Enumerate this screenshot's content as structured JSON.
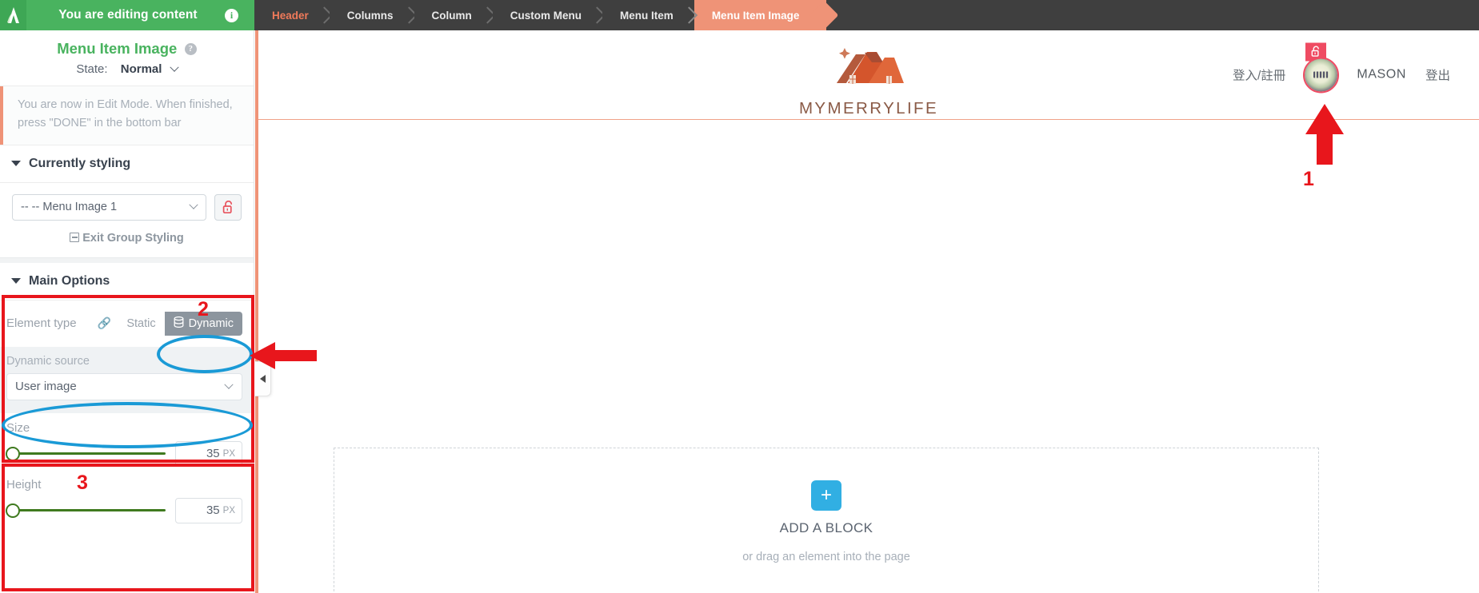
{
  "topbar": {
    "editing_text": "You are editing content",
    "info_icon": "info-icon",
    "breadcrumbs": [
      {
        "label": "Header",
        "state": "first"
      },
      {
        "label": "Columns",
        "state": "normal"
      },
      {
        "label": "Column",
        "state": "normal"
      },
      {
        "label": "Custom Menu",
        "state": "normal"
      },
      {
        "label": "Menu Item",
        "state": "normal"
      },
      {
        "label": "Menu Item Image",
        "state": "active"
      }
    ]
  },
  "sidebar": {
    "panel_title": "Menu Item Image",
    "help_icon": "question-mark-icon",
    "state_label": "State:",
    "state_value": "Normal",
    "notice": "You are now in Edit Mode. When finished, press \"DONE\" in the bottom bar",
    "currently_styling": {
      "section_label": "Currently styling",
      "selected_element": "-- -- Menu Image 1",
      "lock_icon": "unlocked-padlock-icon",
      "exit_group_label": "Exit Group Styling"
    },
    "main_options": {
      "section_label": "Main Options",
      "element_type_label": "Element type",
      "chain_icon": "link-chain-icon",
      "static_label": "Static",
      "dynamic_label": "Dynamic",
      "dynamic_icon": "database-icon",
      "selected_type": "Dynamic",
      "dynamic_source_label": "Dynamic source",
      "dynamic_source_value": "User image"
    },
    "size_options": {
      "size_label": "Size",
      "size_value": "35",
      "size_unit": "PX",
      "height_label": "Height",
      "height_value": "35",
      "height_unit": "PX"
    }
  },
  "preview": {
    "brand_name": "MYMERRYLIFE",
    "logo_icon": "house-roof-logo-icon",
    "nav": {
      "login_register": "登入/註冊",
      "username": "MASON",
      "logout": "登出",
      "avatar_icon": "user-avatar",
      "avatar_badge_icon": "unlocked-padlock-icon"
    },
    "add_block": {
      "plus_icon": "plus-icon",
      "title": "ADD A BLOCK",
      "subtitle": "or drag an element into the page"
    }
  },
  "annotations": {
    "marker_1": "1",
    "marker_2": "2",
    "marker_3": "3",
    "arrow_up_icon": "red-up-arrow-icon",
    "arrow_left_icon": "red-left-arrow-icon",
    "collapse_icon": "collapse-panel-icon"
  },
  "colors": {
    "green": "#49b35f",
    "salmon": "#ef9377",
    "annotation_red": "#e8161c",
    "annotation_blue": "#1a9ad6",
    "slider_green": "#3f7a1f",
    "blue_button": "#31afe3"
  }
}
